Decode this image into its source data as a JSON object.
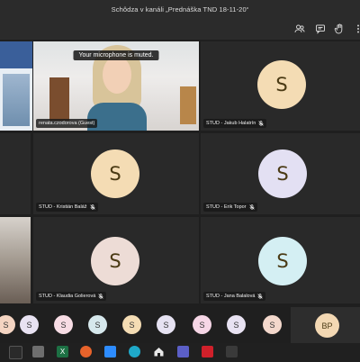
{
  "window": {
    "title": "Schôdza v kanáli „Prednáška TND 18-11-20“"
  },
  "toolbar": {
    "icons": [
      "participants-icon",
      "chat-icon",
      "raise-hand-icon",
      "more-icon"
    ]
  },
  "notification": {
    "text": "Your microphone is muted."
  },
  "presenter": {
    "name": "renata.czodorova (Guest)"
  },
  "participants": [
    {
      "name": "STUD - Jakub Halatrín",
      "initial": "S",
      "color": "#f4dcb4"
    },
    {
      "name": "STUD - Kristián Baláž",
      "initial": "S",
      "color": "#f4dcb4"
    },
    {
      "name": "STUD - Erik Topor",
      "initial": "S",
      "color": "#e3e0f3"
    },
    {
      "name": "STUD - Klaudia Golierová",
      "initial": "S",
      "color": "#eddcd6"
    },
    {
      "name": "STUD - Jana Balalová",
      "initial": "S",
      "color": "#d4eff3"
    }
  ],
  "strip": [
    {
      "initial": "S",
      "color": "#f4d4c2"
    },
    {
      "initial": "S",
      "color": "#e8e2f2"
    },
    {
      "initial": "S",
      "color": "#f7dce4"
    },
    {
      "initial": "S",
      "color": "#d6e8ec"
    },
    {
      "initial": "S",
      "color": "#f4dcb4"
    },
    {
      "initial": "S",
      "color": "#e6e2f2"
    },
    {
      "initial": "S",
      "color": "#f6d6e6"
    },
    {
      "initial": "S",
      "color": "#e8e2f2"
    },
    {
      "initial": "S",
      "color": "#f3d8cc"
    }
  ],
  "current_user": {
    "initials": "BP"
  },
  "taskbar": {
    "icons": [
      "teams-icon",
      "app-icon",
      "excel-icon",
      "firefox-icon",
      "zoom-icon",
      "edge-icon",
      "home-icon",
      "teams-app-icon",
      "acrobat-icon",
      "app-icon-2"
    ]
  }
}
